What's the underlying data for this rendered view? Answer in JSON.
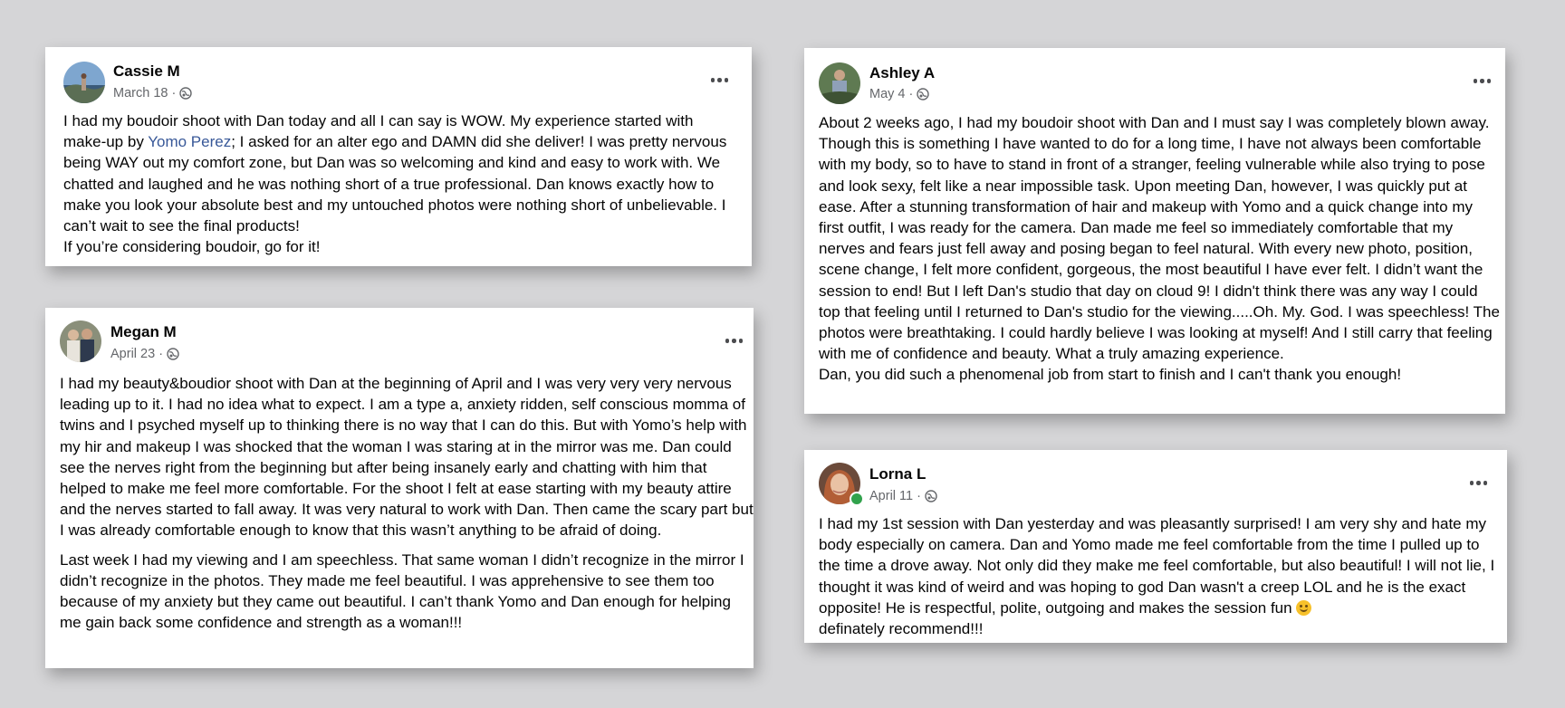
{
  "posts": [
    {
      "name": "Cassie M",
      "date": "March 18 ·",
      "before_link": "I had my boudoir shoot with Dan today and all I can say is WOW. My experience started with make-up by ",
      "link": "Yomo Perez",
      "after_link": "; I asked for an alter ego and DAMN did she deliver! I was pretty nervous being WAY out my comfort zone, but Dan was so welcoming and kind and easy to work with. We chatted and laughed and he was nothing short of a true professional. Dan knows exactly how to make you look your absolute best and my untouched photos were nothing short of unbelievable. I can’t wait to see the final products!",
      "line2": "If you’re considering boudoir, go for it!"
    },
    {
      "name": "Megan M",
      "date": "April 23 ·",
      "para1": "I had my beauty&boudior shoot with Dan at the beginning of April and I was very very very nervous leading up to it.  I had no idea what to expect.  I am a type a, anxiety ridden, self conscious momma of twins and I psyched myself up to thinking there is no way that I can do this.  But with Yomo’s help with my hir and makeup I was shocked that the woman I was staring at in the mirror was me.  Dan could see the nerves right from the beginning but after being insanely early and chatting with him that helped to make me feel more comfortable.  For the shoot I felt at ease starting with my beauty attire and the nerves started to fall away.  It was very natural to work with Dan.  Then came the scary part but I was already comfortable enough to know that this wasn’t anything to be afraid of doing.",
      "para2": "Last week I had my viewing and I am speechless.  That same woman I didn’t recognize in the mirror I didn’t recognize in the photos.  They made me feel beautiful.  I was apprehensive to see them too because of my anxiety but they came out beautiful.  I can’t thank Yomo and Dan enough for helping me gain back some confidence and strength as a woman!!!"
    },
    {
      "name": "Ashley A",
      "date": "May 4 ·",
      "para1": "About 2 weeks ago, I had my boudoir shoot with Dan and I must say I was completely blown away. Though this is something I have wanted to do for a long time, I have not always been comfortable with my body, so to have to stand in front of a stranger, feeling vulnerable while also trying to pose and look sexy, felt like a near impossible task. Upon meeting Dan, however, I was quickly put at ease. After a stunning transformation of hair and makeup with Yomo and a quick change into my first outfit, I was ready for the camera. Dan made me feel so immediately comfortable that my nerves and fears just fell away and posing began to feel natural. With every new photo, position, scene change, I felt more confident, gorgeous, the most beautiful I have ever felt. I didn’t want the session to end! But I left Dan's studio that day on cloud 9! I didn't think there was any way I could top that feeling until I returned to Dan's studio for the viewing.....Oh. My. God. I was speechless! The photos were breathtaking.  I could hardly believe I was looking at myself! And I still carry that feeling with me of confidence and beauty. What a truly amazing experience.",
      "line2": "Dan, you did such a phenomenal job from start to finish and I can't thank you enough!"
    },
    {
      "name": "Lorna L",
      "date": "April 11 ·",
      "para1": "I had my 1st session with Dan yesterday and was pleasantly surprised! I am very shy and hate my body especially on camera. Dan and Yomo made me feel comfortable from the time I pulled up to the time a drove away. Not only did they make me feel comfortable, but also beautiful! I will not lie, I thought it was kind of weird and was hoping to god Dan wasn't a creep LOL and he is the exact opposite! He is respectful, polite, outgoing and makes the session fun ",
      "line2": "definately recommend!!!"
    }
  ],
  "colors": {
    "background": "#d5d5d7",
    "link": "#385898",
    "meta": "#65676b",
    "online": "#31a24c"
  },
  "icons": [
    "globe-icon",
    "more-options-icon",
    "smiling-face-emoji"
  ]
}
